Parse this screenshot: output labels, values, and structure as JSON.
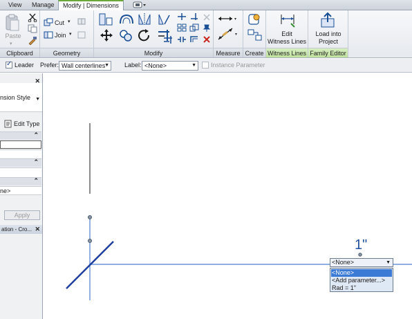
{
  "tabs": {
    "view": "View",
    "manage": "Manage",
    "modify_dimensions": "Modify | Dimensions"
  },
  "ribbon": {
    "paste_label": "Paste",
    "cut_label": "Cut",
    "join_label": "Join",
    "edit_witness_line1": "Edit",
    "edit_witness_line2": "Witness Lines",
    "load_into_line1": "Load into",
    "load_into_line2": "Project",
    "panels": {
      "clipboard": "Clipboard",
      "geometry": "Geometry",
      "modify": "Modify",
      "measure": "Measure",
      "create": "Create",
      "witness_lines": "Witness Lines",
      "family_editor": "Family Editor"
    }
  },
  "options_bar": {
    "leader_label": "Leader",
    "leader_checked": true,
    "prefer_label": "Prefer:",
    "prefer_value": "Wall centerlines",
    "label_label": "Label:",
    "label_value": "<None>",
    "instance_param_label": "Instance Parameter"
  },
  "properties": {
    "type_name": "nsion Style",
    "edit_type": "Edit Type",
    "value_partial": "ne>",
    "apply": "Apply",
    "project_browser_title": "ation - Cro..."
  },
  "canvas": {
    "dimension_text": "1\"",
    "label_dropdown_value": "<None>",
    "dropdown_options": [
      "<None>",
      "<Add parameter...>",
      "Rad = 1\""
    ],
    "selected_option_index": 0
  },
  "colors": {
    "dimension_blue": "#1f4f9c",
    "selection_blue": "#3b7bd6",
    "active_tab_green": "#6aa83c"
  }
}
